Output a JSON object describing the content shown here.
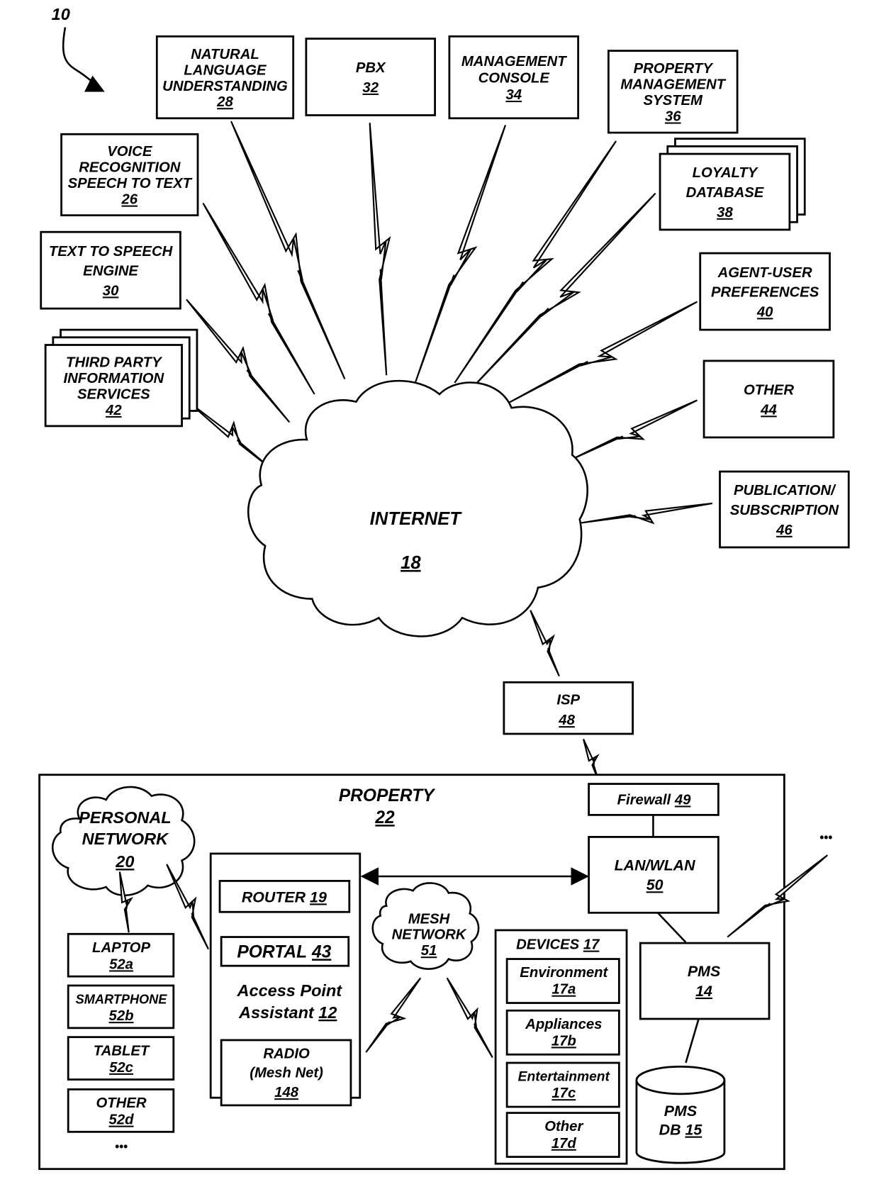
{
  "figure": {
    "ref": "10",
    "internet": {
      "label": "INTERNET",
      "ref": "18"
    },
    "external_services": [
      {
        "id": "nlu",
        "lines": [
          "NATURAL",
          "LANGUAGE",
          "UNDERSTANDING"
        ],
        "ref": "28"
      },
      {
        "id": "pbx",
        "lines": [
          "PBX"
        ],
        "ref": "32"
      },
      {
        "id": "mgmt",
        "lines": [
          "MANAGEMENT",
          "CONSOLE"
        ],
        "ref": "34"
      },
      {
        "id": "pms-ext",
        "lines": [
          "PROPERTY",
          "MANAGEMENT",
          "SYSTEM"
        ],
        "ref": "36"
      },
      {
        "id": "voice",
        "lines": [
          "VOICE",
          "RECOGNITION",
          "SPEECH TO TEXT"
        ],
        "ref": "26"
      },
      {
        "id": "loyalty",
        "lines": [
          "LOYALTY",
          "DATABASE"
        ],
        "ref": "38"
      },
      {
        "id": "tts",
        "lines": [
          "TEXT TO SPEECH",
          "ENGINE"
        ],
        "ref": "30"
      },
      {
        "id": "agent",
        "lines": [
          "AGENT-USER",
          "PREFERENCES"
        ],
        "ref": "40"
      },
      {
        "id": "third",
        "lines": [
          "THIRD PARTY",
          "INFORMATION",
          "SERVICES"
        ],
        "ref": "42"
      },
      {
        "id": "other44",
        "lines": [
          "OTHER"
        ],
        "ref": "44"
      },
      {
        "id": "pubsub",
        "lines": [
          "PUBLICATION/",
          "SUBSCRIPTION"
        ],
        "ref": "46"
      }
    ],
    "isp": {
      "label": "ISP",
      "ref": "48"
    },
    "property": {
      "label": "PROPERTY",
      "ref": "22",
      "firewall": {
        "label": "Firewall",
        "ref": "49"
      },
      "lan": {
        "label": "LAN/WLAN",
        "ref": "50"
      },
      "personal_network": {
        "lines": [
          "PERSONAL",
          "NETWORK"
        ],
        "ref": "20"
      },
      "user_devices": [
        {
          "label": "LAPTOP",
          "ref": "52a"
        },
        {
          "label": "SMARTPHONE",
          "ref": "52b"
        },
        {
          "label": "TABLET",
          "ref": "52c"
        },
        {
          "label": "OTHER",
          "ref": "52d"
        }
      ],
      "more_devices": "•••",
      "access_point": {
        "router": {
          "label": "ROUTER",
          "ref": "19"
        },
        "portal": {
          "label": "PORTAL",
          "ref": "43"
        },
        "title_lines": [
          "Access Point",
          "Assistant"
        ],
        "ref": "12",
        "radio": {
          "lines": [
            "RADIO",
            "(Mesh Net)"
          ],
          "ref": "148"
        }
      },
      "mesh": {
        "lines": [
          "MESH",
          "NETWORK"
        ],
        "ref": "51"
      },
      "devices": {
        "label": "DEVICES",
        "ref": "17",
        "items": [
          {
            "label": "Environment",
            "ref": "17a"
          },
          {
            "label": "Appliances",
            "ref": "17b"
          },
          {
            "label": "Entertainment",
            "ref": "17c"
          },
          {
            "label": "Other",
            "ref": "17d"
          }
        ]
      },
      "pms": {
        "label": "PMS",
        "ref": "14"
      },
      "pms_db": {
        "lines": [
          "PMS",
          "DB"
        ],
        "ref": "15"
      }
    },
    "more_properties": "•••"
  }
}
